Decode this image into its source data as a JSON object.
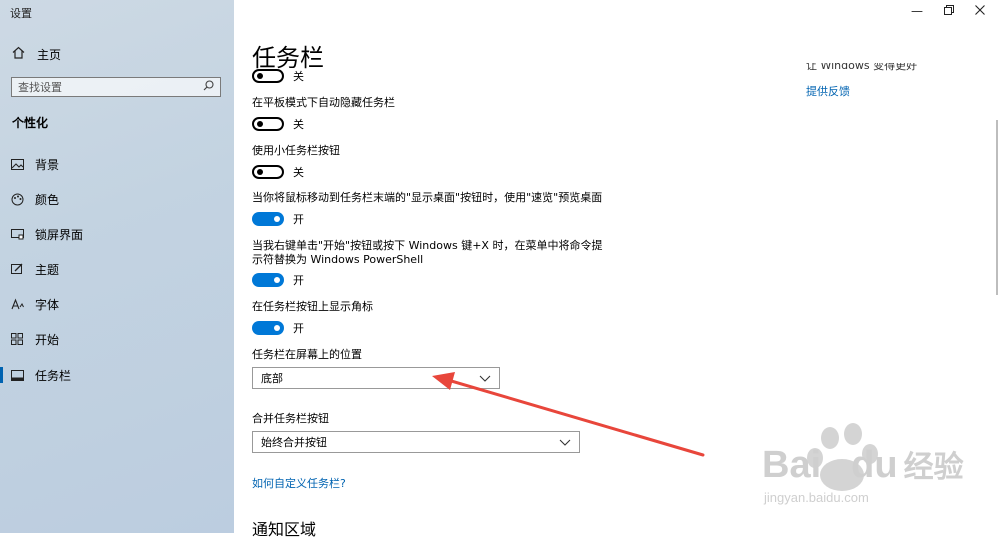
{
  "window": {
    "title": "设置"
  },
  "sidebar": {
    "home_label": "主页",
    "search_placeholder": "查找设置",
    "section": "个性化",
    "items": [
      {
        "label": "背景",
        "icon": "image-icon"
      },
      {
        "label": "颜色",
        "icon": "palette-icon"
      },
      {
        "label": "锁屏界面",
        "icon": "lock-screen-icon"
      },
      {
        "label": "主题",
        "icon": "theme-icon"
      },
      {
        "label": "字体",
        "icon": "font-icon"
      },
      {
        "label": "开始",
        "icon": "start-icon"
      },
      {
        "label": "任务栏",
        "icon": "taskbar-icon",
        "active": true
      }
    ]
  },
  "main": {
    "title": "任务栏",
    "toggle_top_state": "关",
    "tablet_hide": {
      "label": "在平板模式下自动隐藏任务栏",
      "state": "关"
    },
    "small_buttons": {
      "label": "使用小任务栏按钮",
      "state": "关"
    },
    "peek": {
      "label": "当你将鼠标移动到任务栏末端的\"显示桌面\"按钮时，使用\"速览\"预览桌面",
      "state": "开"
    },
    "powershell": {
      "label_line1": "当我右键单击\"开始\"按钮或按下 Windows 键+X 时，在菜单中将命令提",
      "label_line2": "示符替换为 Windows PowerShell",
      "state": "开"
    },
    "badges": {
      "label": "在任务栏按钮上显示角标",
      "state": "开"
    },
    "position": {
      "label": "任务栏在屏幕上的位置",
      "value": "底部"
    },
    "combine": {
      "label": "合并任务栏按钮",
      "value": "始终合并按钮"
    },
    "customize_link": "如何自定义任务栏?",
    "notification_heading": "通知区域"
  },
  "right_panel": {
    "partial_text": "让 Windows 变得更好",
    "feedback_link": "提供反馈"
  },
  "watermark": {
    "brand": "Bai",
    "brand2": "du",
    "brand_cn": "经验",
    "url": "jingyan.baidu.com"
  },
  "colors": {
    "accent": "#0078d7",
    "link": "#0063b1",
    "arrow": "#e8463b"
  }
}
